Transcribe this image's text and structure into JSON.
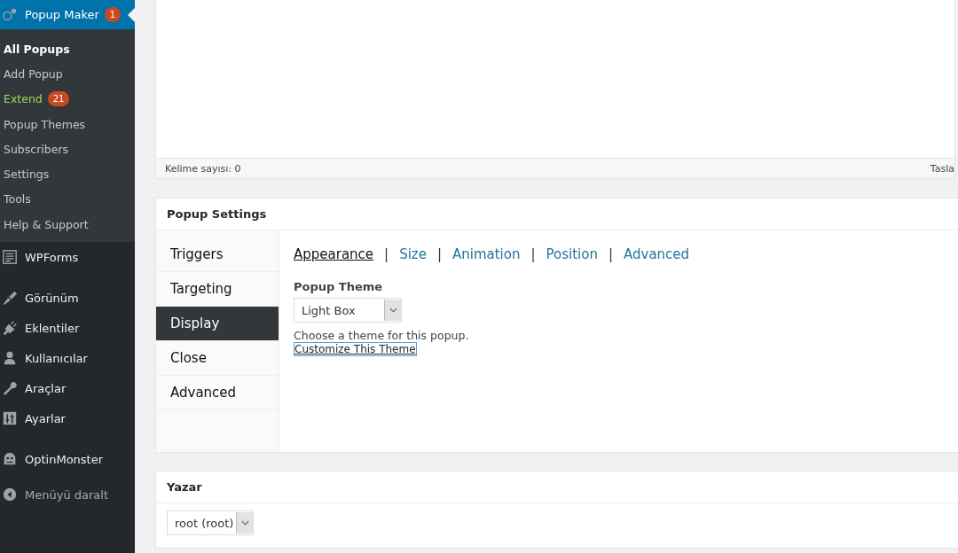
{
  "sidebar": {
    "groups": [
      [
        {
          "label": "Popup Maker",
          "badge": "1",
          "current": true,
          "submenu": [
            {
              "label": "All Popups",
              "selected": true
            },
            {
              "label": "Add Popup",
              "selected": false
            },
            {
              "label": "Extend",
              "kind": "promo",
              "badge": "21",
              "selected": false
            },
            {
              "label": "Popup Themes",
              "selected": false
            },
            {
              "label": "Subscribers",
              "selected": false
            },
            {
              "label": "Settings",
              "selected": false
            },
            {
              "label": "Tools",
              "selected": false
            },
            {
              "label": "Help & Support",
              "selected": false
            }
          ]
        }
      ],
      [
        {
          "label": "WPForms",
          "current": false
        }
      ],
      [
        {
          "label": "Görünüm",
          "current": false
        },
        {
          "label": "Eklentiler",
          "current": false
        },
        {
          "label": "Kullanıcılar",
          "current": false
        },
        {
          "label": "Araçlar",
          "current": false
        },
        {
          "label": "Ayarlar",
          "current": false
        }
      ],
      [
        {
          "label": "OptinMonster",
          "current": false
        }
      ]
    ],
    "collapse": "Menüyü daralt"
  },
  "editor": {
    "word_count": "Kelime sayısı: 0",
    "status": "Tasla"
  },
  "popup_settings": {
    "title": "Popup Settings",
    "tabs": [
      {
        "label": "Triggers",
        "selected": false
      },
      {
        "label": "Targeting",
        "selected": false
      },
      {
        "label": "Display",
        "selected": true
      },
      {
        "label": "Close",
        "selected": false
      },
      {
        "label": "Advanced",
        "selected": false
      }
    ],
    "subtabs": [
      {
        "label": "Appearance",
        "selected": true
      },
      {
        "label": "Size",
        "selected": false
      },
      {
        "label": "Animation",
        "selected": false
      },
      {
        "label": "Position",
        "selected": false
      },
      {
        "label": "Advanced",
        "selected": false
      }
    ],
    "separator": "|",
    "field_label": "Popup Theme",
    "theme_value": "Light Box",
    "description": "Choose a theme for this popup.",
    "customize_link": "Customize This Theme"
  },
  "author": {
    "title": "Yazar",
    "value": "root (root)"
  }
}
